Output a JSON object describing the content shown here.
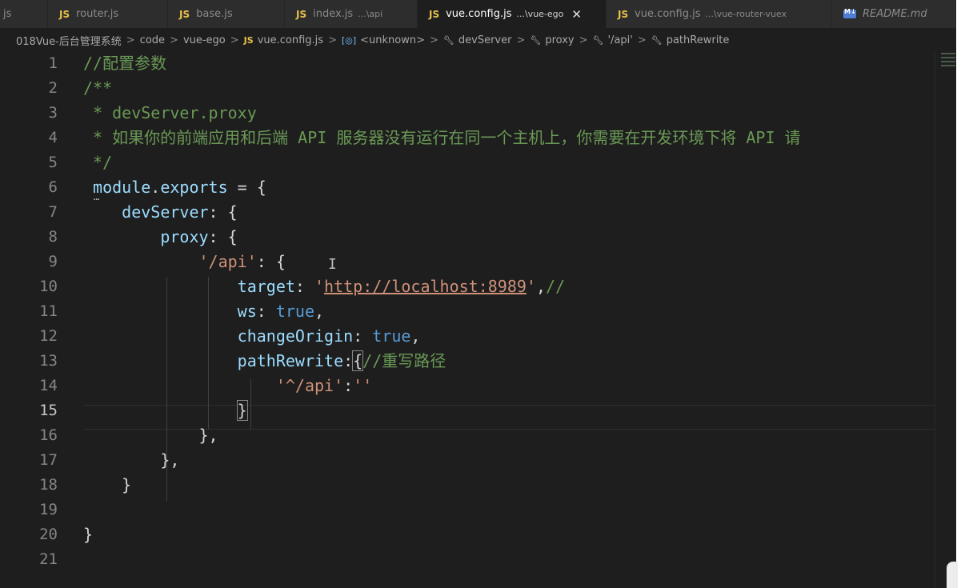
{
  "tabs": [
    {
      "label": "js",
      "type": "js-partial"
    },
    {
      "label": "router.js",
      "type": "js"
    },
    {
      "label": "base.js",
      "type": "js"
    },
    {
      "label": "index.js",
      "path": "...\\api",
      "type": "js"
    },
    {
      "label": "vue.config.js",
      "path": "...\\vue-ego",
      "type": "js",
      "active": true
    },
    {
      "label": "vue.config.js",
      "path": "...\\vue-router-vuex",
      "type": "js"
    },
    {
      "label": "README.md",
      "type": "md"
    }
  ],
  "js_badge": "JS",
  "close_glyph": "✕",
  "breadcrumb": [
    {
      "label": "018Vue-后台管理系统"
    },
    {
      "label": "code"
    },
    {
      "label": "vue-ego"
    },
    {
      "label": "vue.config.js",
      "icon": "js"
    },
    {
      "label": "<unknown>",
      "icon": "object"
    },
    {
      "label": "devServer",
      "icon": "wrench"
    },
    {
      "label": "proxy",
      "icon": "wrench"
    },
    {
      "label": "'/api'",
      "icon": "wrench"
    },
    {
      "label": "pathRewrite",
      "icon": "wrench"
    }
  ],
  "breadcrumb_sep": ">",
  "editor": {
    "current_line": 15,
    "lines": [
      {
        "n": "1",
        "t": "//配置参数"
      },
      {
        "n": "2",
        "t": "/**"
      },
      {
        "n": "3",
        "t": " * devServer.proxy"
      },
      {
        "n": "4",
        "t": " * 如果你的前端应用和后端 API 服务器没有运行在同一个主机上，你需要在开发环境下将 API 请"
      },
      {
        "n": "5",
        "t": " */"
      },
      {
        "n": "6",
        "t": " module.exports = {"
      },
      {
        "n": "7",
        "t": "    devServer: {"
      },
      {
        "n": "8",
        "t": "        proxy: {"
      },
      {
        "n": "9",
        "t": "            '/api': {"
      },
      {
        "n": "10",
        "t": "                target: 'http://localhost:8989',//"
      },
      {
        "n": "11",
        "t": "                ws: true,"
      },
      {
        "n": "12",
        "t": "                changeOrigin: true,"
      },
      {
        "n": "13",
        "t": "                pathRewrite:{//重写路径"
      },
      {
        "n": "14",
        "t": "                    '^/api':''"
      },
      {
        "n": "15",
        "t": "                }"
      },
      {
        "n": "16",
        "t": "            },"
      },
      {
        "n": "17",
        "t": "        },"
      },
      {
        "n": "18",
        "t": "    }"
      },
      {
        "n": "19",
        "t": ""
      },
      {
        "n": "20",
        "t": "}"
      },
      {
        "n": "21",
        "t": ""
      }
    ]
  },
  "colors": {
    "comment": "#6a9955",
    "keyword": "#569cd6",
    "property": "#9cdcfe",
    "string": "#ce9178",
    "text": "#d4d4d4",
    "js_icon": "#e8c14a"
  }
}
